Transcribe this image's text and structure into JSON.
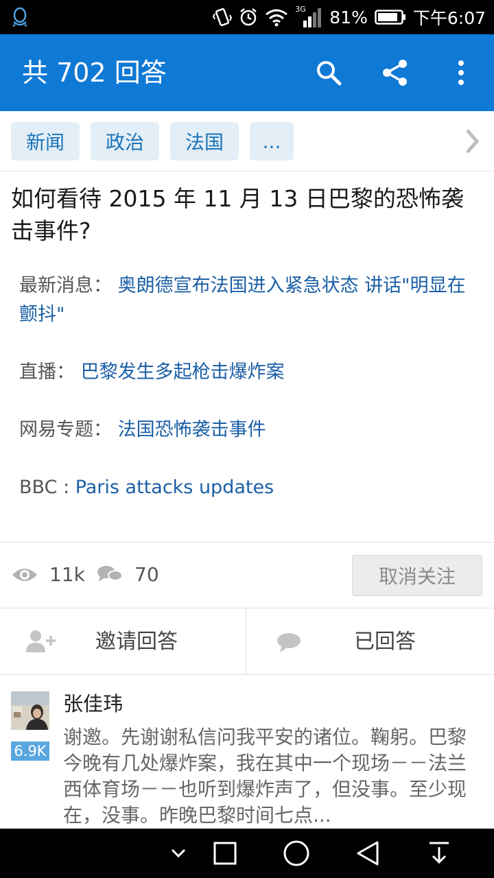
{
  "status_bar": {
    "network": "3G",
    "battery": "81%",
    "time": "下午6:07",
    "icons": [
      "qq-icon",
      "vibrate-icon",
      "alarm-icon",
      "wifi-icon",
      "signal-icon",
      "battery-icon"
    ]
  },
  "app_bar": {
    "title": "共 702 回答",
    "actions": [
      "search-icon",
      "share-icon",
      "more-icon"
    ]
  },
  "tags": [
    "新闻",
    "政治",
    "法国",
    "..."
  ],
  "question": {
    "title": "如何看待 2015 年 11 月 13 日巴黎的恐怖袭击事件?",
    "details": [
      {
        "label": "最新消息：",
        "link": "奥朗德宣布法国进入紧急状态 讲话\"明显在颤抖\""
      },
      {
        "label": "直播：",
        "link": "巴黎发生多起枪击爆炸案"
      },
      {
        "label": "网易专题：",
        "link": "法国恐怖袭击事件"
      },
      {
        "label": "BBC : ",
        "link": "Paris attacks updates"
      }
    ]
  },
  "stats": {
    "views": "11k",
    "comments": "70",
    "unfollow_label": "取消关注"
  },
  "actions": {
    "invite_label": "邀请回答",
    "answered_label": "已回答"
  },
  "answer": {
    "author": "张佳玮",
    "reputation": "6.9K",
    "excerpt": "谢邀。先谢谢私信问我平安的诸位。鞠躬。巴黎今晚有几处爆炸案，我在其中一个现场－－法兰西体育场－－也听到爆炸声了，但没事。至少现在，没事。昨晚巴黎时间七点..."
  },
  "colors": {
    "app_bar": "#0f79d6",
    "tag_bg": "#e3eef6",
    "link": "#1b5fa6",
    "badge": "#5aa7e0"
  }
}
